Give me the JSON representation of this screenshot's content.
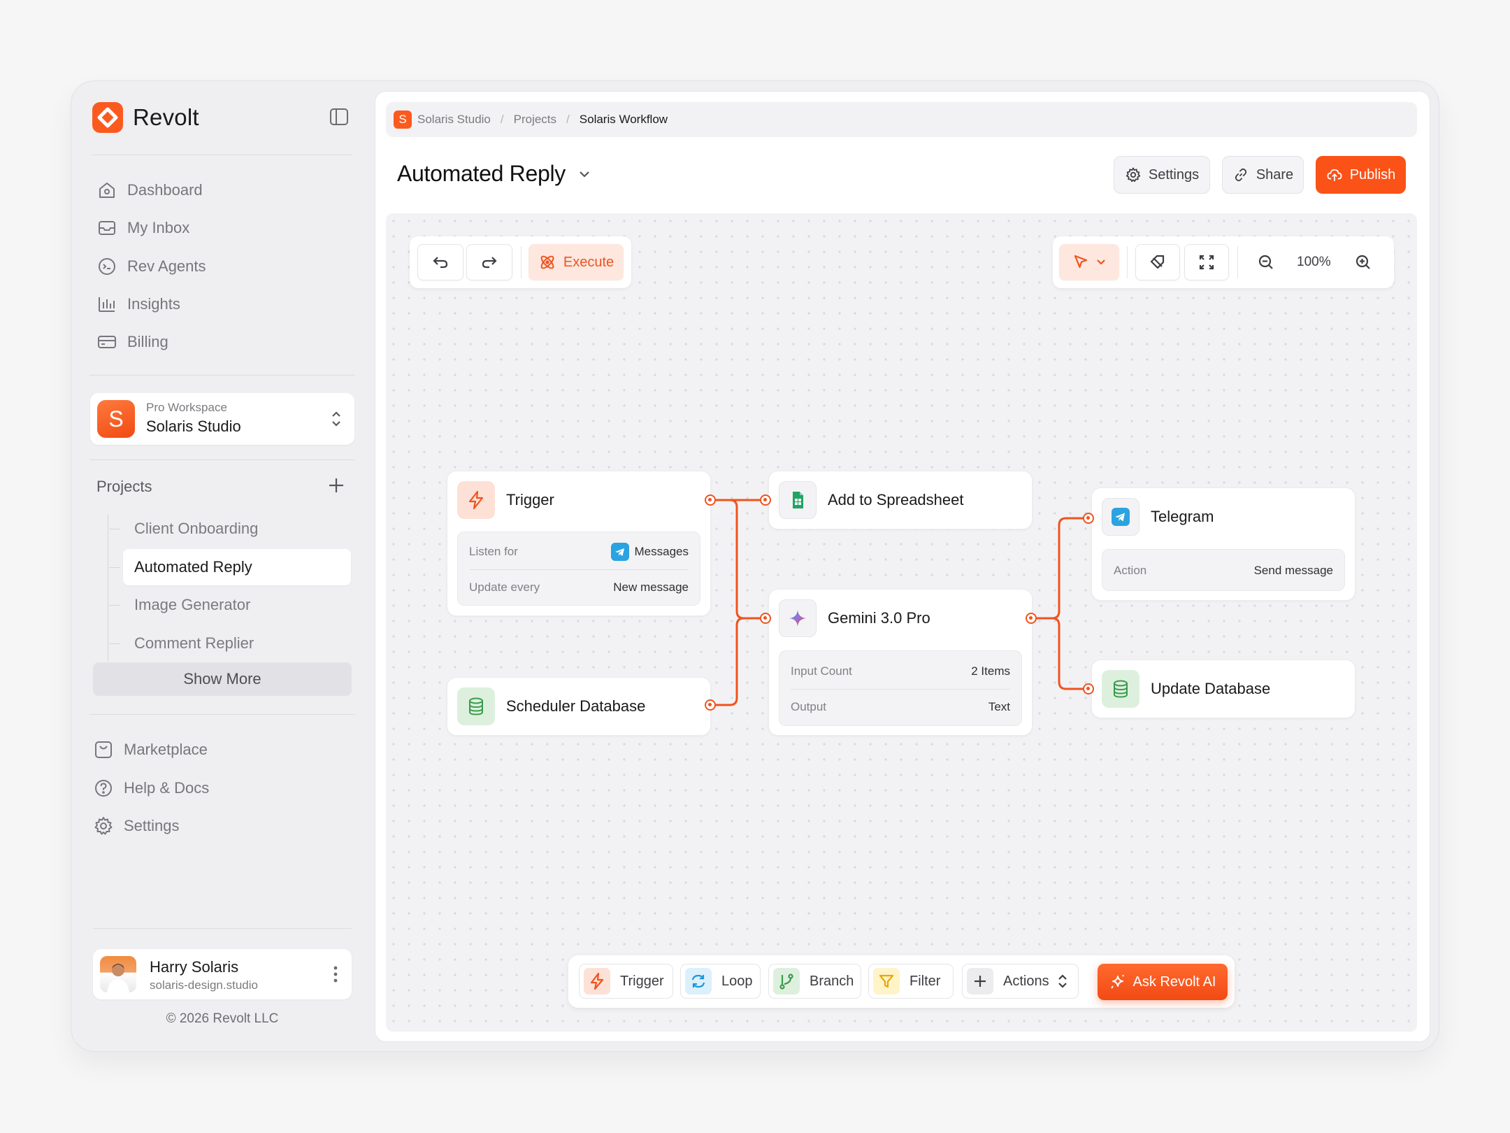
{
  "brand": {
    "name": "Revolt",
    "logo_color": "#fb5a1f"
  },
  "sidebar": {
    "nav": [
      {
        "label": "Dashboard",
        "icon": "home-icon"
      },
      {
        "label": "My Inbox",
        "icon": "inbox-icon"
      },
      {
        "label": "Rev Agents",
        "icon": "agent-icon"
      },
      {
        "label": "Insights",
        "icon": "chart-icon"
      },
      {
        "label": "Billing",
        "icon": "card-icon"
      }
    ],
    "workspace": {
      "initial": "S",
      "tier": "Pro Workspace",
      "name": "Solaris Studio"
    },
    "projects_heading": "Projects",
    "projects": [
      {
        "label": "Client Onboarding",
        "active": false
      },
      {
        "label": "Automated Reply",
        "active": true
      },
      {
        "label": "Image Generator",
        "active": false
      },
      {
        "label": "Comment Replier",
        "active": false
      }
    ],
    "show_more": "Show More",
    "footer_nav": [
      {
        "label": "Marketplace",
        "icon": "store-icon"
      },
      {
        "label": "Help & Docs",
        "icon": "help-icon"
      },
      {
        "label": "Settings",
        "icon": "gear-icon"
      }
    ],
    "user": {
      "name": "Harry Solaris",
      "email": "solaris-design.studio"
    },
    "copyright": "© 2026 Revolt LLC"
  },
  "breadcrumb": {
    "logo_initial": "S",
    "items": [
      "Solaris Studio",
      "Projects",
      "Solaris Workflow"
    ]
  },
  "header": {
    "title": "Automated Reply",
    "settings_label": "Settings",
    "share_label": "Share",
    "publish_label": "Publish",
    "accent_color": "#fb5218"
  },
  "canvas": {
    "execute_label": "Execute",
    "zoom": "100%"
  },
  "nodes": {
    "trigger": {
      "title": "Trigger",
      "rows": [
        {
          "key": "Listen for",
          "value": "Messages"
        },
        {
          "key": "Update every",
          "value": "New message"
        }
      ]
    },
    "scheduler": {
      "title": "Scheduler Database"
    },
    "spreadsheet": {
      "title": "Add to Spreadsheet"
    },
    "gemini": {
      "title": "Gemini 3.0 Pro",
      "rows": [
        {
          "key": "Input Count",
          "value": "2 Items"
        },
        {
          "key": "Output",
          "value": "Text"
        }
      ]
    },
    "telegram": {
      "title": "Telegram",
      "rows": [
        {
          "key": "Action",
          "value": "Send message"
        }
      ]
    },
    "update_db": {
      "title": "Update Database"
    }
  },
  "bottom_bar": {
    "items": [
      {
        "label": "Trigger",
        "icon": "bolt-icon"
      },
      {
        "label": "Loop",
        "icon": "loop-icon"
      },
      {
        "label": "Branch",
        "icon": "branch-icon"
      },
      {
        "label": "Filter",
        "icon": "filter-icon"
      },
      {
        "label": "Actions",
        "icon": "plus-icon"
      }
    ],
    "ask_label": "Ask Revolt AI"
  }
}
